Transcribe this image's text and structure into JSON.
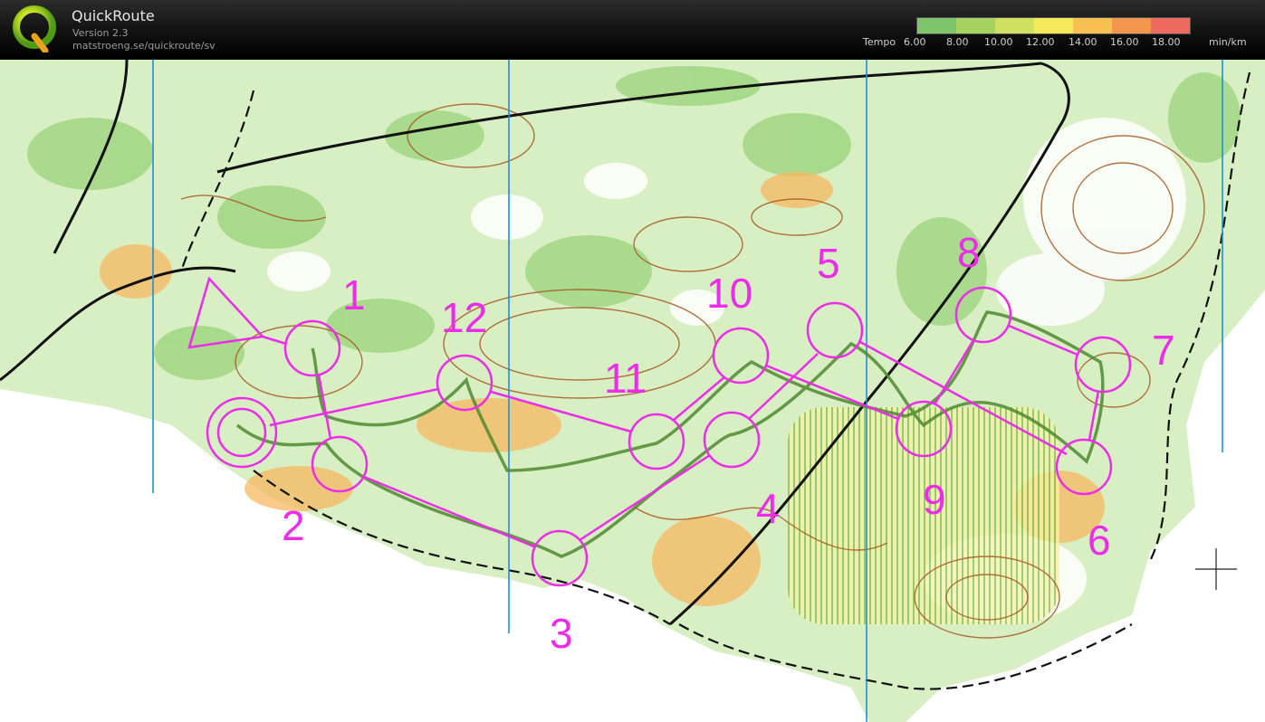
{
  "app": {
    "title": "QuickRoute",
    "version": "Version 2.3",
    "url": "matstroeng.se/quickroute/sv"
  },
  "legend": {
    "label": "Tempo",
    "unit": "min/km",
    "ticks": [
      "6.00",
      "8.00",
      "10.00",
      "12.00",
      "14.00",
      "16.00",
      "18.00"
    ],
    "colors": [
      "#7ec46a",
      "#a6d262",
      "#d0e060",
      "#f4ea5a",
      "#f6c052",
      "#f3964e",
      "#ef6a5e"
    ]
  },
  "map": {
    "course_color": "#ec2ce8",
    "meridian_color": "#1f8fd8",
    "control_labels": [
      "1",
      "2",
      "3",
      "4",
      "5",
      "6",
      "7",
      "8",
      "9",
      "10",
      "11",
      "12"
    ]
  }
}
